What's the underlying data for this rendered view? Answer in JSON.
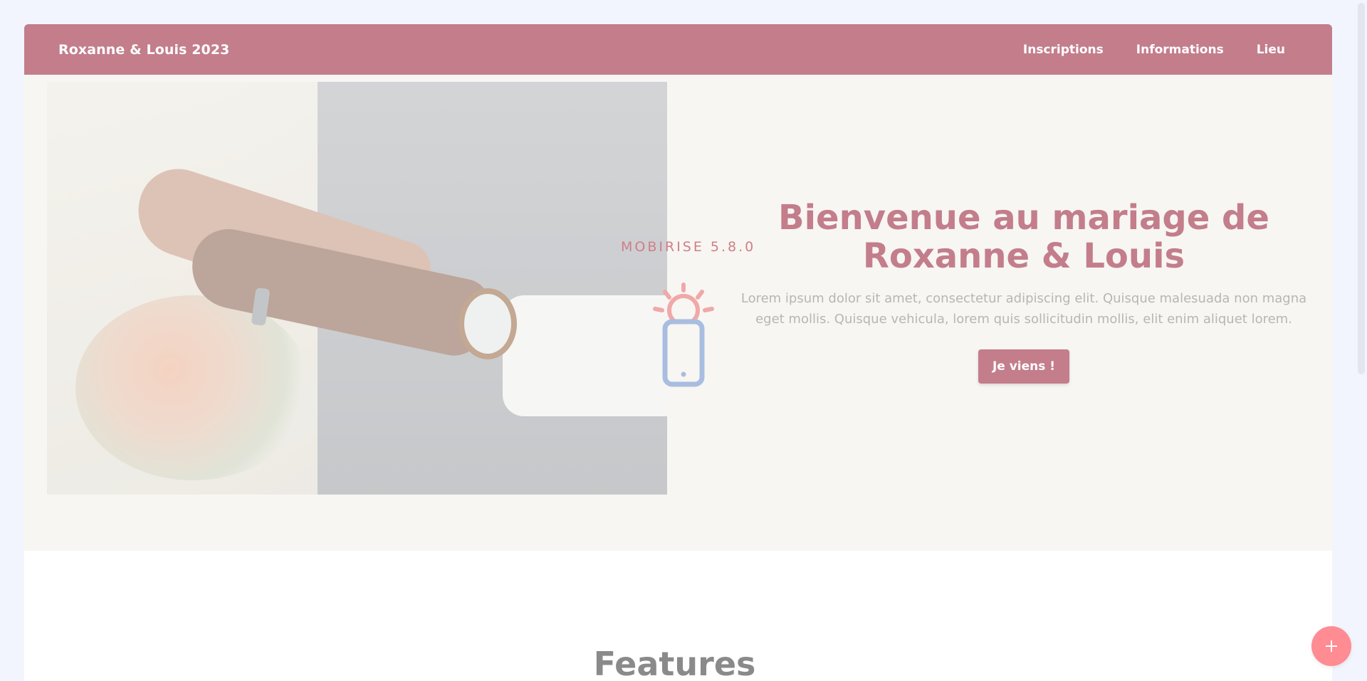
{
  "navbar": {
    "brand": "Roxanne & Louis 2023",
    "links": [
      "Inscriptions",
      "Informations",
      "Lieu"
    ]
  },
  "hero": {
    "title_line1": "Bienvenue au mariage de",
    "title_line2": "Roxanne & Louis",
    "description": "Lorem ipsum dolor sit amet, consectetur adipiscing elit. Quisque malesuada non magna eget mollis. Quisque vehicula, lorem quis sollicitudin mollis, elit enim aliquet lorem.",
    "cta_label": "Je viens !"
  },
  "watermark": {
    "label": "MOBIRISE  5.8.0"
  },
  "features": {
    "title": "Features"
  },
  "colors": {
    "accent": "#c37d8b",
    "fab": "#ff8c93",
    "hero_bg": "#f7f6f2"
  },
  "icons": {
    "fab": "plus-icon",
    "watermark": "phone-sun-icon"
  }
}
